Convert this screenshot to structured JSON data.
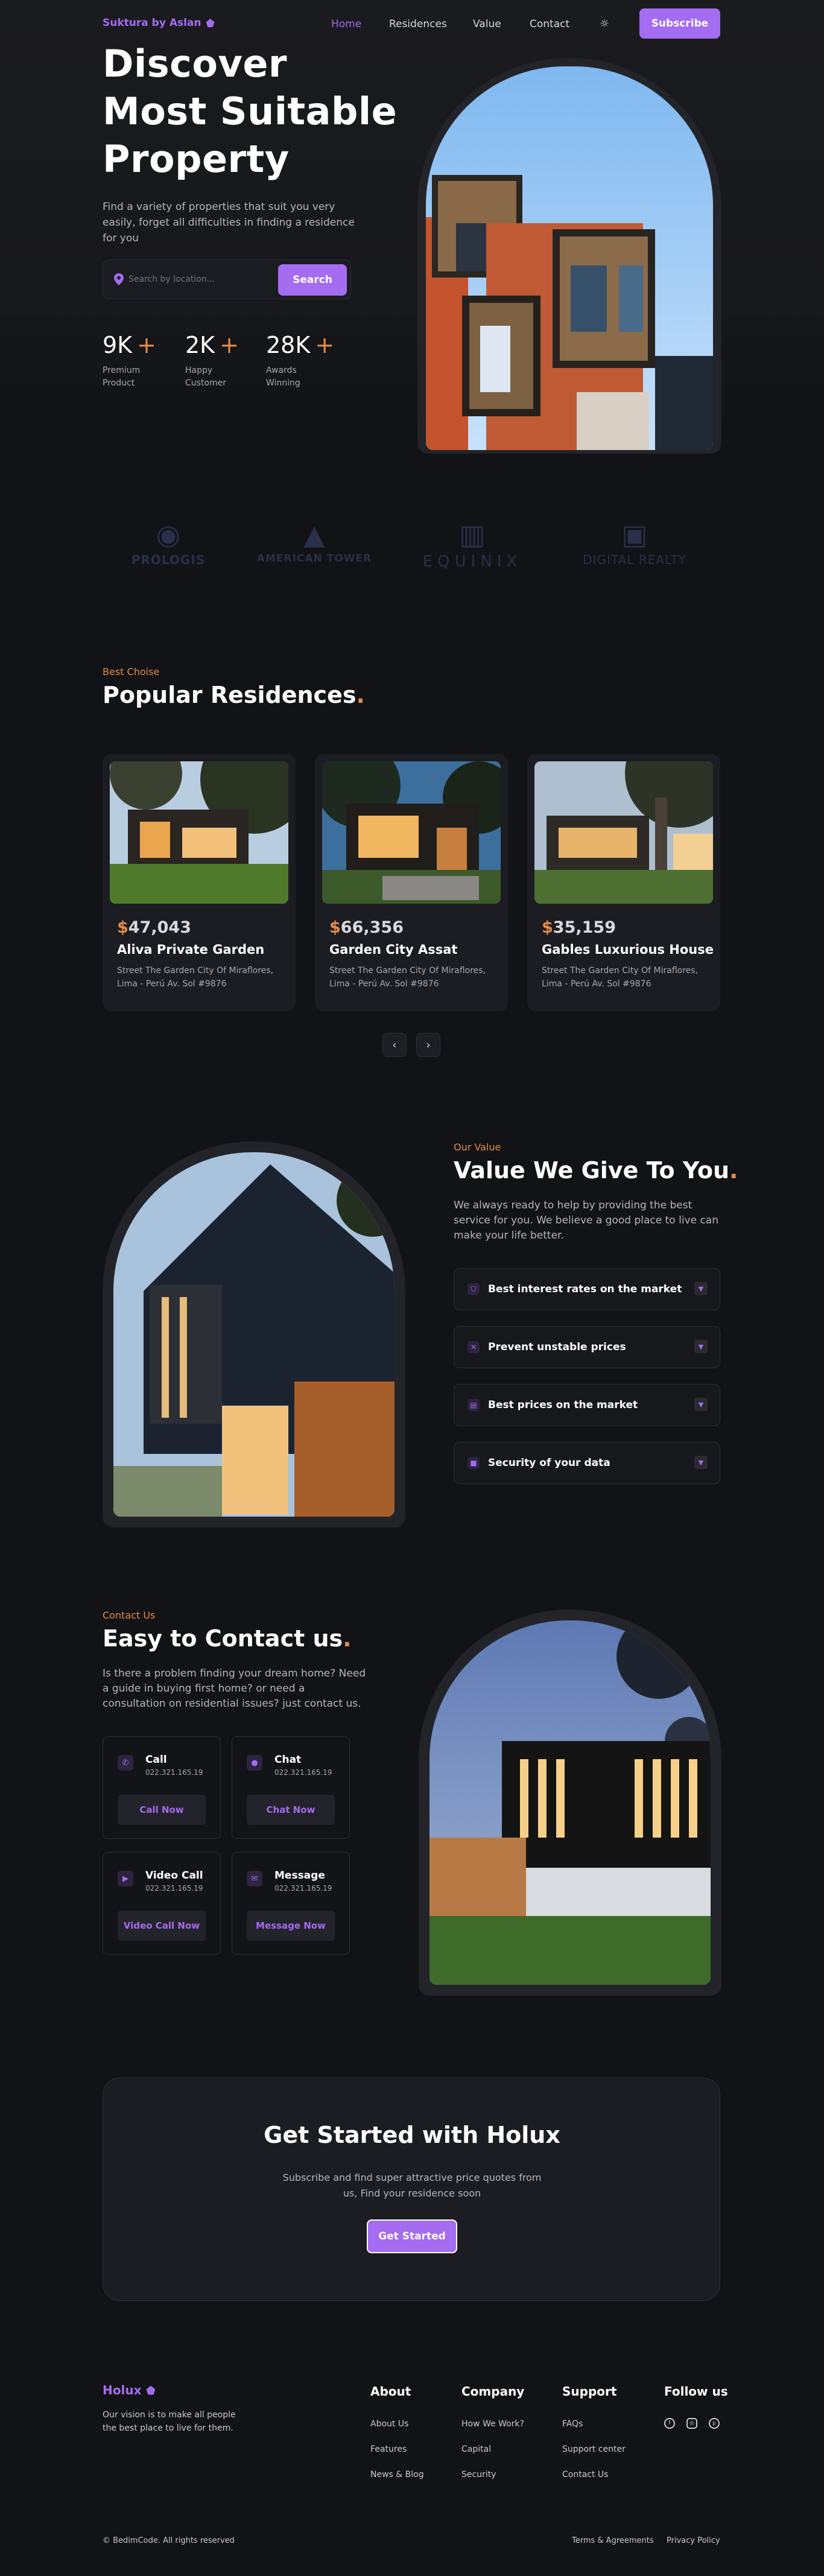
{
  "nav": {
    "brand": "Suktura by Aslan",
    "links": [
      "Home",
      "Residences",
      "Value",
      "Contact"
    ],
    "subscribe": "Subscribe"
  },
  "hero": {
    "title": "Discover\nMost Suitable\nProperty",
    "desc": "Find a variety of properties that suit you very easily, forget all difficulties in finding a residence for you",
    "search_placeholder": "Search by location...",
    "search_button": "Search",
    "stats": [
      {
        "value": "9K",
        "plus": "+",
        "label": "Premium\nProduct"
      },
      {
        "value": "2K",
        "plus": "+",
        "label": "Happy\nCustomer"
      },
      {
        "value": "28K",
        "plus": "+",
        "label": "Awards\nWinning"
      }
    ]
  },
  "partners": [
    "PROLOGIS",
    "AMERICAN TOWER",
    "EQUINIX",
    "DIGITAL REALTY"
  ],
  "residences": {
    "eyebrow": "Best Choise",
    "title": "Popular Residences",
    "dot": ".",
    "cards": [
      {
        "currency": "$",
        "price": "47,043",
        "name": "Aliva Private Garden",
        "address": "Street The Garden City Of Miraflores, Lima - Perú Av. Sol #9876"
      },
      {
        "currency": "$",
        "price": "66,356",
        "name": "Garden City Assat",
        "address": "Street The Garden City Of Miraflores, Lima - Perú Av. Sol #9876"
      },
      {
        "currency": "$",
        "price": "35,159",
        "name": "Gables Luxurious House",
        "address": "Street The Garden City Of Miraflores, Lima - Perú Av. Sol #9876"
      }
    ],
    "prev": "‹",
    "next": "›"
  },
  "value": {
    "eyebrow": "Our Value",
    "title": "Value We Give To You",
    "dot": ".",
    "desc": "We always ready to help by providing the best service for you. We believe a good place to live can make your life better.",
    "items": [
      {
        "label": "Best interest rates on the market",
        "icon": "shield-icon"
      },
      {
        "label": "Prevent unstable prices",
        "icon": "close-square-icon"
      },
      {
        "label": "Best prices on the market",
        "icon": "chart-icon"
      },
      {
        "label": "Security of your data",
        "icon": "lock-icon"
      }
    ]
  },
  "contact": {
    "eyebrow": "Contact Us",
    "title": "Easy to Contact us",
    "dot": ".",
    "desc": "Is there a problem finding your dream home? Need a guide in buying first home? or need a consultation on residential issues? just contact us.",
    "items": [
      {
        "title": "Call",
        "number": "022.321.165.19",
        "button": "Call Now",
        "icon": "phone-icon"
      },
      {
        "title": "Chat",
        "number": "022.321.165.19",
        "button": "Chat Now",
        "icon": "chat-icon"
      },
      {
        "title": "Video Call",
        "number": "022.321.165.19",
        "button": "Video Call Now",
        "icon": "video-icon"
      },
      {
        "title": "Message",
        "number": "022.321.165.19",
        "button": "Message Now",
        "icon": "mail-icon"
      }
    ]
  },
  "cta": {
    "title": "Get Started with Holux",
    "desc": "Subscribe and find super attractive price quotes from us, Find your residence soon",
    "button": "Get Started"
  },
  "footer": {
    "brand": "Holux",
    "tagline": "Our vision is to make all people the best place to live for them.",
    "columns": [
      {
        "heading": "About",
        "links": [
          "About Us",
          "Features",
          "News & Blog"
        ]
      },
      {
        "heading": "Company",
        "links": [
          "How We Work?",
          "Capital",
          "Security"
        ]
      },
      {
        "heading": "Support",
        "links": [
          "FAQs",
          "Support center",
          "Contact Us"
        ]
      }
    ],
    "follow": "Follow us",
    "copyright": "© BedimCode. All rights reserved",
    "terms": "Terms & Agreements",
    "privacy": "Privacy Policy"
  },
  "colors": {
    "accent": "#a46cf0",
    "orange": "#e38b4a",
    "background": "#121316"
  }
}
